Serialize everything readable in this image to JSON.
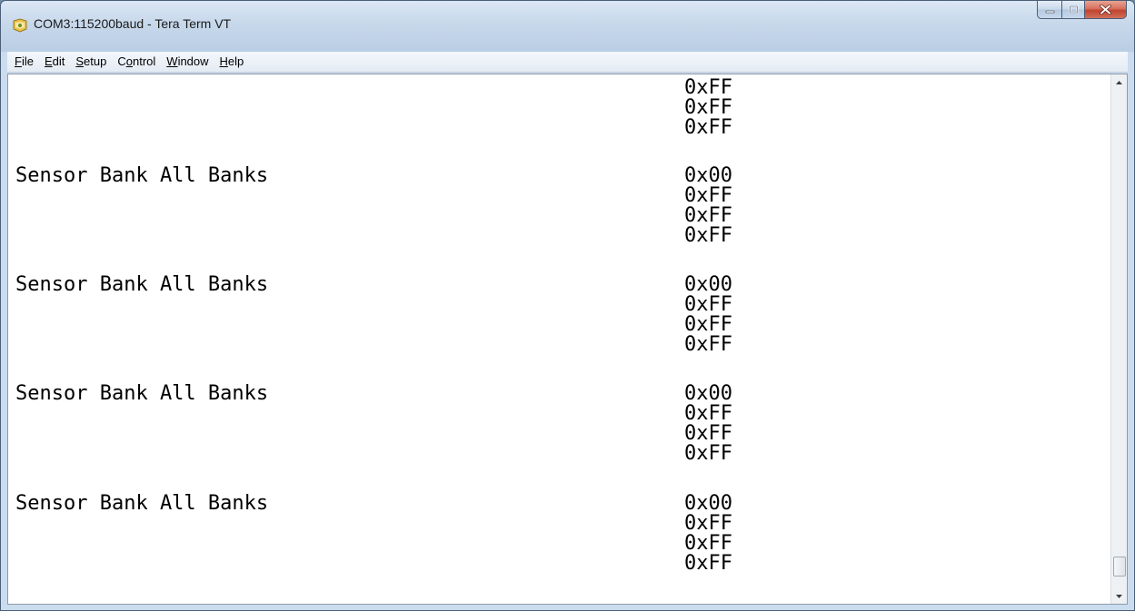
{
  "window": {
    "title": "COM3:115200baud - Tera Term VT",
    "icons": {
      "app": "tera-term-icon",
      "minimize": "minimize-icon",
      "maximize": "maximize-icon",
      "close": "close-icon"
    }
  },
  "menubar": {
    "items": [
      {
        "key": "F",
        "rest": "ile"
      },
      {
        "key": "E",
        "rest": "dit"
      },
      {
        "key": "S",
        "rest": "etup"
      },
      {
        "pre": "C",
        "key": "o",
        "rest": "ntrol"
      },
      {
        "key": "W",
        "rest": "indow"
      },
      {
        "key": "H",
        "rest": "elp"
      }
    ]
  },
  "terminal": {
    "lines": [
      {
        "hex": "0xFF"
      },
      {
        "hex": "0xFF"
      },
      {
        "hex": "0xFF"
      },
      {
        "label": "Sensor Bank All Banks",
        "hex": "0x00"
      },
      {
        "hex": "0xFF"
      },
      {
        "hex": "0xFF"
      },
      {
        "hex": "0xFF"
      },
      {
        "label": "Sensor Bank All Banks",
        "hex": "0x00"
      },
      {
        "hex": "0xFF"
      },
      {
        "hex": "0xFF"
      },
      {
        "hex": "0xFF"
      },
      {
        "label": "Sensor Bank All Banks",
        "hex": "0x00"
      },
      {
        "hex": "0xFF"
      },
      {
        "hex": "0xFF"
      },
      {
        "hex": "0xFF"
      },
      {
        "label": "Sensor Bank All Banks",
        "hex": "0x00"
      },
      {
        "hex": "0xFF"
      },
      {
        "hex": "0xFF"
      },
      {
        "hex": "0xFF"
      }
    ]
  },
  "scrollbar": {
    "up_icon": "scroll-up-arrow-icon",
    "down_icon": "scroll-down-arrow-icon",
    "position": 1.0
  },
  "colors": {
    "terminal_background": "#ffffff",
    "terminal_text": "#000000",
    "close_button": "#c7503a"
  }
}
